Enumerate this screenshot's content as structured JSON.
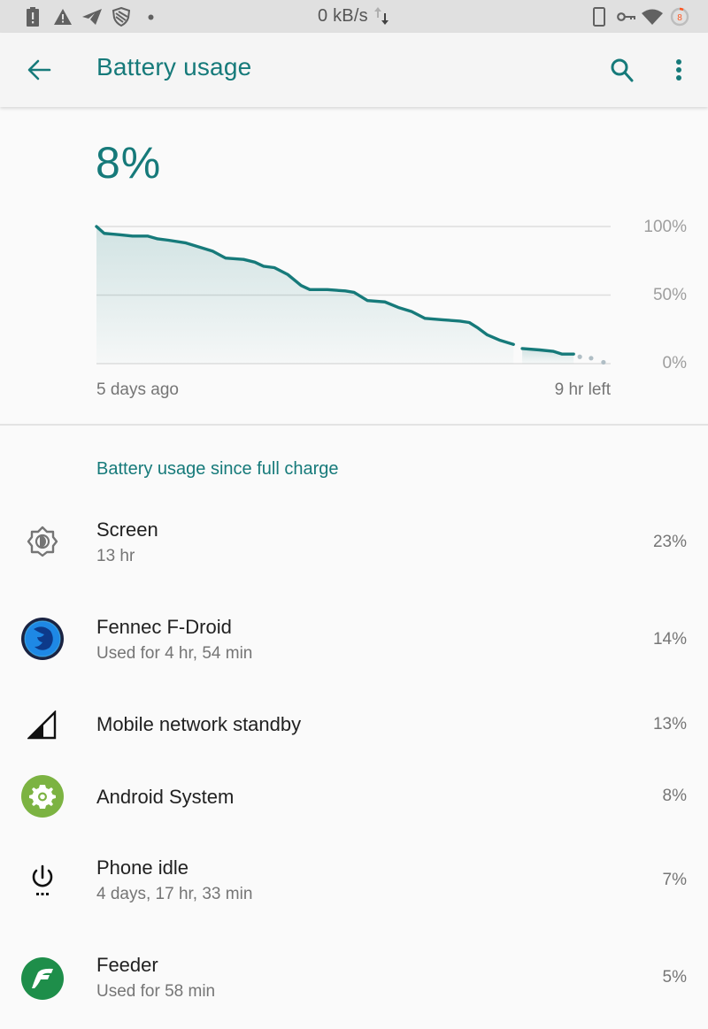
{
  "status_bar": {
    "left_icons": [
      "battery-alert-icon",
      "warning-icon",
      "telegram-icon",
      "shield-icon",
      "dot-icon"
    ],
    "network_speed": "0 kB/s",
    "right_icons": [
      "phone-icon",
      "vpn-key-icon",
      "wifi-icon",
      "battery-ring-icon"
    ],
    "battery_ring_value": "8",
    "battery_ring_color": "#ff5722"
  },
  "app_bar": {
    "title": "Battery usage",
    "back_icon": "arrow-back-icon",
    "search_icon": "search-icon",
    "more_icon": "more-vert-icon"
  },
  "summary": {
    "battery_percent": "8%",
    "accent_color": "#167a7a"
  },
  "chart_data": {
    "type": "area",
    "title": "",
    "xlabel": "",
    "ylabel": "",
    "ylim": [
      0,
      100
    ],
    "y_ticks": [
      "100%",
      "50%",
      "0%"
    ],
    "x_labels": {
      "start": "5 days ago",
      "end": "9 hr left"
    },
    "x_range": [
      0,
      1
    ],
    "grid": true,
    "series": [
      {
        "name": "battery-level-history",
        "style": "solid",
        "x": [
          0,
          0.015,
          0.045,
          0.07,
          0.1,
          0.119,
          0.14,
          0.174,
          0.2,
          0.226,
          0.251,
          0.286,
          0.308,
          0.325,
          0.346,
          0.372,
          0.398,
          0.415,
          0.449,
          0.484,
          0.501,
          0.527,
          0.561,
          0.587,
          0.613,
          0.639,
          0.673,
          0.707,
          0.725,
          0.742,
          0.76,
          0.785,
          0.811
        ],
        "values": [
          100,
          95,
          94,
          93,
          93,
          91,
          90,
          88,
          85,
          82,
          77,
          76,
          74,
          71,
          70,
          65,
          57,
          54,
          54,
          53,
          52,
          46,
          45,
          41,
          38,
          33,
          32,
          31,
          30,
          26,
          21,
          17,
          14
        ]
      },
      {
        "name": "battery-level-history-after-gap",
        "style": "solid",
        "x": [
          0.828,
          0.862,
          0.888,
          0.905,
          0.928
        ],
        "values": [
          11,
          10,
          9,
          7,
          7
        ]
      },
      {
        "name": "battery-level-projection",
        "style": "dotted",
        "x": [
          0.94,
          0.962,
          0.986
        ],
        "values": [
          5,
          4,
          1
        ]
      }
    ],
    "line_color": "#167a7a",
    "projection_color": "#b0bec5"
  },
  "usage": {
    "section_title": "Battery usage since full charge",
    "items": [
      {
        "icon": "brightness-icon",
        "title": "Screen",
        "subtitle": "13 hr",
        "percent": "23%"
      },
      {
        "icon": "fennec-app-icon",
        "title": "Fennec F-Droid",
        "subtitle": "Used for 4 hr, 54 min",
        "percent": "14%"
      },
      {
        "icon": "cell-signal-icon",
        "title": "Mobile network standby",
        "subtitle": "",
        "percent": "13%"
      },
      {
        "icon": "android-system-icon",
        "title": "Android System",
        "subtitle": "",
        "percent": "8%"
      },
      {
        "icon": "power-idle-icon",
        "title": "Phone idle",
        "subtitle": "4 days, 17 hr, 33 min",
        "percent": "7%"
      },
      {
        "icon": "feeder-app-icon",
        "title": "Feeder",
        "subtitle": "Used for 58 min",
        "percent": "5%"
      }
    ]
  }
}
